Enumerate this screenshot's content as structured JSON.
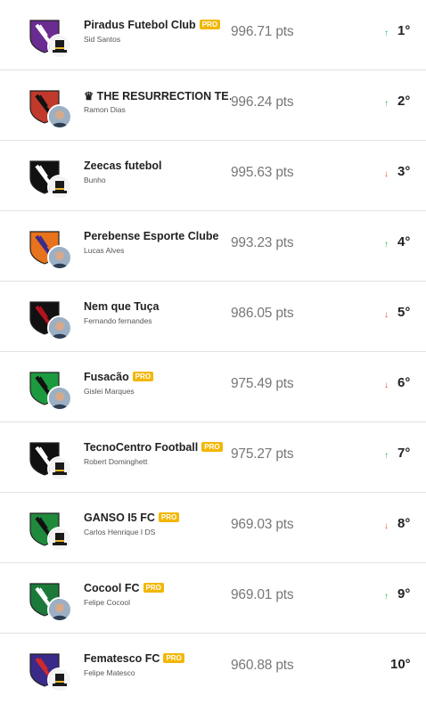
{
  "ranking": [
    {
      "team": "Piradus Futebol Club",
      "pro": true,
      "owner": "Sid Santos",
      "points": "996.71 pts",
      "trend": "up",
      "trend_icon": "arrow-up-icon",
      "position": "1°",
      "crest_colors": [
        "#6a2c91",
        "#ffffff"
      ],
      "avatar": "top-hat"
    },
    {
      "team": "♛ THE RESURRECTION TE…",
      "pro": false,
      "owner": "Ramon Dias",
      "points": "996.24 pts",
      "trend": "up",
      "trend_icon": "arrow-up-icon",
      "position": "2°",
      "crest_colors": [
        "#c0392b",
        "#111111"
      ],
      "avatar": "photo"
    },
    {
      "team": "Zeecas futebol",
      "pro": false,
      "owner": "Bunho",
      "points": "995.63 pts",
      "trend": "down",
      "trend_icon": "arrow-down-icon",
      "position": "3°",
      "crest_colors": [
        "#111111",
        "#ffffff"
      ],
      "avatar": "top-hat"
    },
    {
      "team": "Perebense Esporte Clube",
      "pro": false,
      "owner": "Lucas Alves",
      "points": "993.23 pts",
      "trend": "up",
      "trend_icon": "arrow-up-icon",
      "position": "4°",
      "crest_colors": [
        "#e8731c",
        "#3b2a8a"
      ],
      "avatar": "photo"
    },
    {
      "team": "Nem que Tuça",
      "pro": false,
      "owner": "Fernando fernandes",
      "points": "986.05 pts",
      "trend": "down",
      "trend_icon": "arrow-down-icon",
      "position": "5°",
      "crest_colors": [
        "#111111",
        "#b3121f"
      ],
      "avatar": "photo"
    },
    {
      "team": "Fusacão",
      "pro": true,
      "owner": "Gislei Marques",
      "points": "975.49 pts",
      "trend": "down",
      "trend_icon": "arrow-down-icon",
      "position": "6°",
      "crest_colors": [
        "#1d9a3f",
        "#111111"
      ],
      "avatar": "photo"
    },
    {
      "team": "TecnoCentro Football",
      "pro": true,
      "owner": "Robert Dominghett",
      "points": "975.27 pts",
      "trend": "up",
      "trend_icon": "arrow-up-icon",
      "position": "7°",
      "crest_colors": [
        "#111111",
        "#ffffff"
      ],
      "avatar": "top-hat"
    },
    {
      "team": "GANSO I5 FC",
      "pro": true,
      "owner": "Carlos Henrique I DS",
      "points": "969.03 pts",
      "trend": "down",
      "trend_icon": "arrow-down-icon",
      "position": "8°",
      "crest_colors": [
        "#1f8a3c",
        "#111111"
      ],
      "avatar": "top-hat"
    },
    {
      "team": "Cocool FC",
      "pro": true,
      "owner": "Felipe Cocool",
      "points": "969.01 pts",
      "trend": "up",
      "trend_icon": "arrow-up-icon",
      "position": "9°",
      "crest_colors": [
        "#1b7a3a",
        "#ffffff"
      ],
      "avatar": "photo"
    },
    {
      "team": "Fematesco FC",
      "pro": true,
      "owner": "Felipe Matesco",
      "points": "960.88 pts",
      "trend": "none",
      "trend_icon": "",
      "position": "10°",
      "crest_colors": [
        "#3a2a8a",
        "#d12a2a"
      ],
      "avatar": "top-hat"
    }
  ],
  "labels": {
    "pro": "PRO",
    "arrow_up": "↑",
    "arrow_down": "↓"
  }
}
